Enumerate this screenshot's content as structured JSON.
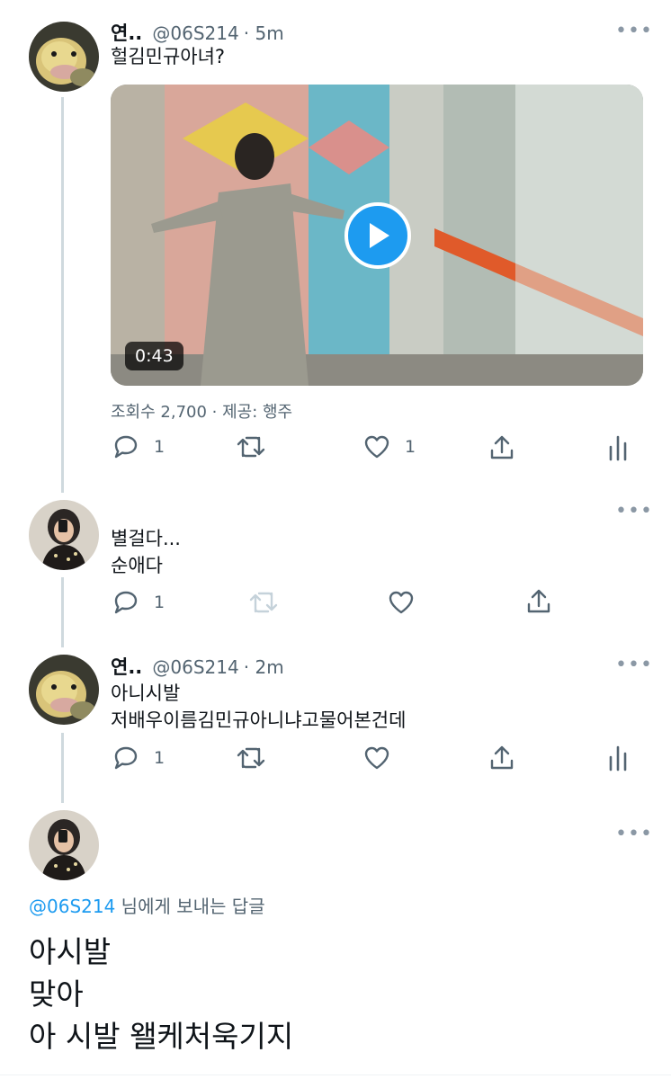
{
  "tweets": [
    {
      "author": "연..",
      "handle": "@06S214",
      "time": "5m",
      "lines": [
        "헐김민규아녀?"
      ],
      "media": {
        "duration": "0:43",
        "views": "조회수 2,700 · 제공: 행주"
      },
      "actions": {
        "reply_count": "1",
        "like_count": "1"
      },
      "more": "•••"
    },
    {
      "lines": [
        "별걸다...",
        "순애다"
      ],
      "actions": {
        "reply_count": "1"
      },
      "more": "•••"
    },
    {
      "author": "연..",
      "handle": "@06S214",
      "time": "2m",
      "lines": [
        "아니시발",
        "저배우이름김민규아니냐고물어본건데"
      ],
      "actions": {
        "reply_count": "1"
      },
      "more": "•••"
    }
  ],
  "reply_box": {
    "reply_to_handle": "@06S214",
    "reply_to_suffix": " 님에게 보내는 답글",
    "lines": [
      "아시발",
      "맞아",
      "아 시발 왤케처욱기지"
    ],
    "more": "•••"
  },
  "colors": {
    "accent": "#1d9bf0",
    "text": "#0f1419",
    "secondary": "#536471",
    "thread_line": "#cfd9de"
  },
  "icons": [
    "reply-icon",
    "retweet-icon",
    "like-icon",
    "share-icon",
    "analytics-icon",
    "play-icon",
    "more-icon"
  ]
}
